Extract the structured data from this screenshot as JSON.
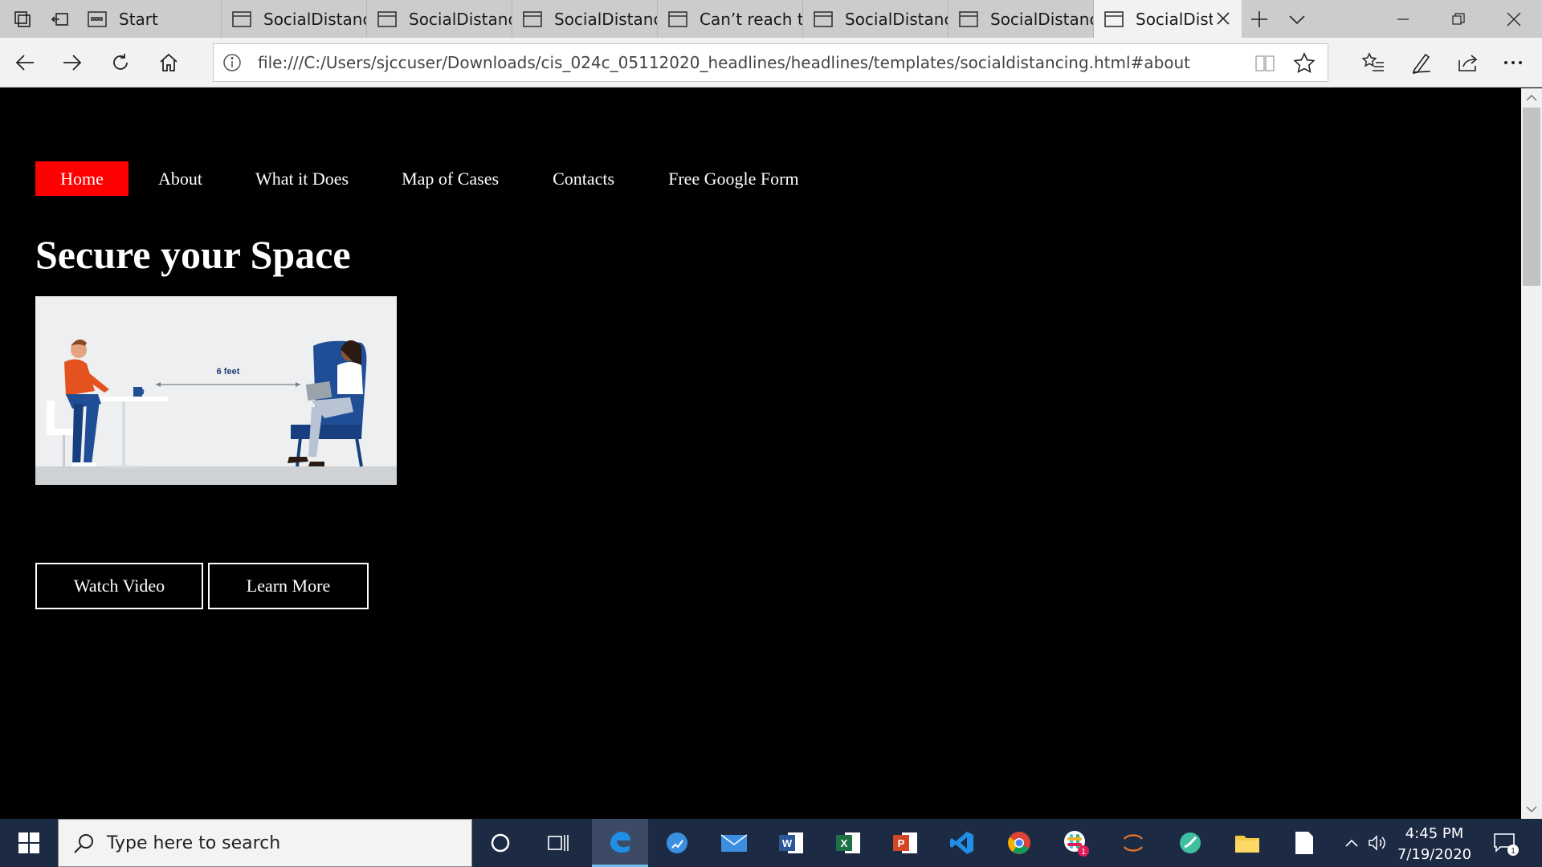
{
  "browser": {
    "tabs": [
      {
        "label": "Start",
        "active": false
      },
      {
        "label": "SocialDistanci",
        "active": false
      },
      {
        "label": "SocialDistanci",
        "active": false
      },
      {
        "label": "SocialDistanci",
        "active": false
      },
      {
        "label": "Can’t reach th",
        "active": false
      },
      {
        "label": "SocialDistanci",
        "active": false
      },
      {
        "label": "SocialDistanci",
        "active": false
      },
      {
        "label": "SocialDist",
        "active": true
      }
    ],
    "url": "file:///C:/Users/sjccuser/Downloads/cis_024c_05112020_headlines/headlines/templates/socialdistancing.html#about"
  },
  "page": {
    "nav": [
      {
        "label": "Home",
        "active": true
      },
      {
        "label": "About",
        "active": false
      },
      {
        "label": "What it Does",
        "active": false
      },
      {
        "label": "Map of Cases",
        "active": false
      },
      {
        "label": "Contacts",
        "active": false
      },
      {
        "label": "Free Google Form",
        "active": false
      }
    ],
    "heading": "Secure your Space",
    "image": {
      "distance_label": "6 feet"
    },
    "buttons": {
      "watch_video": "Watch Video",
      "learn_more": "Learn More"
    },
    "colors": {
      "background": "#000000",
      "nav_active": "#ff0000",
      "text": "#ffffff"
    }
  },
  "taskbar": {
    "search_placeholder": "Type here to search",
    "time": "4:45 PM",
    "date": "7/19/2020",
    "slack_badge": "1",
    "notification_badge": "1"
  }
}
